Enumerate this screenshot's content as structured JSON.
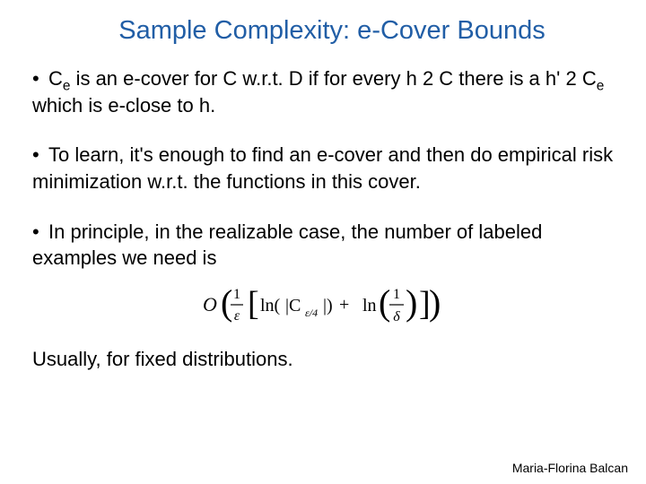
{
  "title_pre": "Sample Complexity: ",
  "title_eps": "e",
  "title_post": "-Cover Bounds",
  "b1": {
    "dot": "•",
    "t1": "C",
    "sub1": "e",
    "t2": " is an ",
    "eps1": "e",
    "t3": "-cover for C w.r.t. D if for every h ",
    "in1": "2",
    "t4": " C there is a h' ",
    "in2": "2",
    "t5": " C",
    "sub2": "e",
    "t6": " which is ",
    "eps2": "e",
    "t7": "-close to h."
  },
  "b2": {
    "dot": "•",
    "t1": "To learn, it's enough to find an ",
    "eps": "e",
    "t2": "-cover and then do empirical risk minimization w.r.t. the functions in this cover."
  },
  "b3": {
    "dot": "•",
    "t1": "In principle,  in the realizable case, the number of labeled examples we need is"
  },
  "closing": "Usually, for fixed distributions.",
  "footer": "Maria-Florina Balcan",
  "formula": {
    "O": "O",
    "lp": "(",
    "frac_top1": "1",
    "frac_bot1": "ε",
    "lb": "[",
    "ln1": "ln(",
    "bar": "|C",
    "sub": "ε/4",
    "bar2": "|)",
    "plus": " + ",
    "ln2": "ln",
    "lp2": "(",
    "frac_top2": "1",
    "frac_bot2": "δ",
    "rp2": ")",
    "rb": "]",
    "rp": ")"
  }
}
